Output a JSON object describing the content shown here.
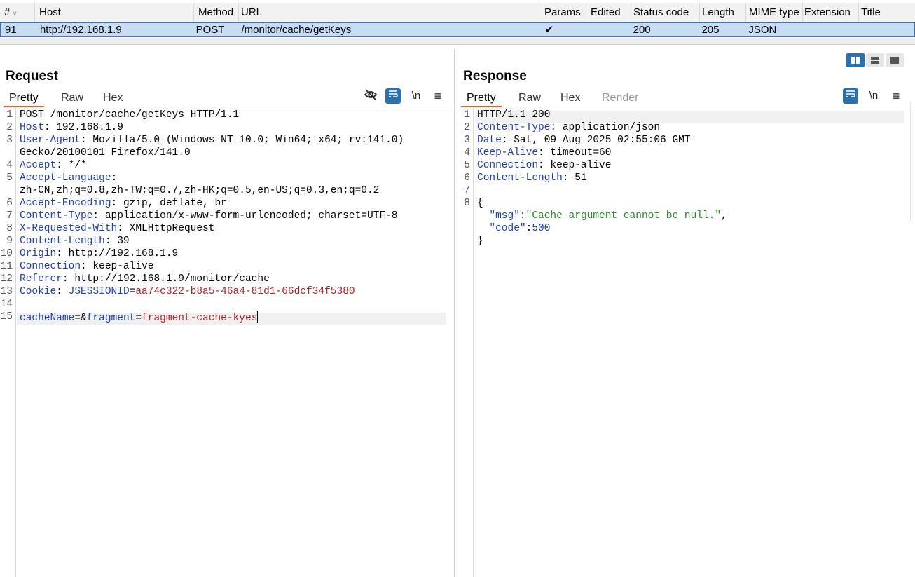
{
  "table": {
    "columns": [
      "#",
      "Host",
      "Method",
      "URL",
      "Params",
      "Edited",
      "Status code",
      "Length",
      "MIME type",
      "Extension",
      "Title"
    ],
    "selected_row": {
      "num": "91",
      "host": "http://192.168.1.9",
      "method": "POST",
      "url": "/monitor/cache/getKeys",
      "params": "✔",
      "edited": "",
      "status": "200",
      "length": "205",
      "mime": "JSON",
      "extension": "",
      "title": ""
    }
  },
  "request": {
    "title": "Request",
    "tabs": [
      "Pretty",
      "Raw",
      "Hex"
    ],
    "active_tab": "Pretty",
    "tools": {
      "wrap_newline": "\\n",
      "menu": "≡"
    },
    "lines": [
      {
        "n": "1",
        "key": "",
        "sep": "",
        "val": "POST /monitor/cache/getKeys HTTP/1.1"
      },
      {
        "n": "2",
        "key": "Host",
        "sep": ": ",
        "val": "192.168.1.9"
      },
      {
        "n": "3",
        "key": "User-Agent",
        "sep": ": ",
        "val": "Mozilla/5.0 (Windows NT 10.0; Win64; x64; rv:141.0)"
      },
      {
        "n": "",
        "key": "",
        "sep": "",
        "val": "Gecko/20100101 Firefox/141.0"
      },
      {
        "n": "4",
        "key": "Accept",
        "sep": ": ",
        "val": "*/*"
      },
      {
        "n": "5",
        "key": "Accept-Language",
        "sep": ":",
        "val": ""
      },
      {
        "n": "",
        "key": "",
        "sep": "",
        "val": "zh-CN,zh;q=0.8,zh-TW;q=0.7,zh-HK;q=0.5,en-US;q=0.3,en;q=0.2"
      },
      {
        "n": "6",
        "key": "Accept-Encoding",
        "sep": ": ",
        "val": "gzip, deflate, br"
      },
      {
        "n": "7",
        "key": "Content-Type",
        "sep": ": ",
        "val": "application/x-www-form-urlencoded; charset=UTF-8"
      },
      {
        "n": "8",
        "key": "X-Requested-With",
        "sep": ": ",
        "val": "XMLHttpRequest"
      },
      {
        "n": "9",
        "key": "Content-Length",
        "sep": ": ",
        "val": "39"
      },
      {
        "n": "10",
        "key": "Origin",
        "sep": ": ",
        "val": "http://192.168.1.9"
      },
      {
        "n": "11",
        "key": "Connection",
        "sep": ": ",
        "val": "keep-alive"
      },
      {
        "n": "12",
        "key": "Referer",
        "sep": ": ",
        "val": "http://192.168.1.9/monitor/cache"
      },
      {
        "n": "13",
        "key": "Cookie",
        "sep": ": ",
        "val": ""
      },
      {
        "n": "14",
        "key": "",
        "sep": "",
        "val": ""
      },
      {
        "n": "15",
        "key": "",
        "sep": "",
        "val": ""
      }
    ],
    "cookie": {
      "name": "JSESSIONID",
      "eq": "=",
      "value": "aa74c322-b8a5-46a4-81d1-66dcf34f5380"
    },
    "body": {
      "p1": "cacheName",
      "eq1": "=&",
      "p2": "fragment",
      "eq2": "=",
      "v2": "fragment-cache-kyes"
    }
  },
  "response": {
    "title": "Response",
    "tabs": [
      "Pretty",
      "Raw",
      "Hex",
      "Render"
    ],
    "active_tab": "Pretty",
    "tools": {
      "wrap_newline": "\\n",
      "menu": "≡"
    },
    "lines": [
      {
        "n": "1",
        "key": "",
        "sep": "",
        "val": "HTTP/1.1 200"
      },
      {
        "n": "2",
        "key": "Content-Type",
        "sep": ": ",
        "val": "application/json"
      },
      {
        "n": "3",
        "key": "Date",
        "sep": ": ",
        "val": "Sat, 09 Aug 2025 02:55:06 GMT"
      },
      {
        "n": "4",
        "key": "Keep-Alive",
        "sep": ": ",
        "val": "timeout=60"
      },
      {
        "n": "5",
        "key": "Connection",
        "sep": ": ",
        "val": "keep-alive"
      },
      {
        "n": "6",
        "key": "Content-Length",
        "sep": ": ",
        "val": "51"
      },
      {
        "n": "7",
        "key": "",
        "sep": "",
        "val": ""
      },
      {
        "n": "8",
        "key": "",
        "sep": "",
        "val": "{"
      }
    ],
    "json": {
      "msg_key": "\"msg\"",
      "msg_val": "\"Cache argument cannot be null.\"",
      "code_key": "\"code\"",
      "code_val": "500",
      "close": "}"
    }
  }
}
